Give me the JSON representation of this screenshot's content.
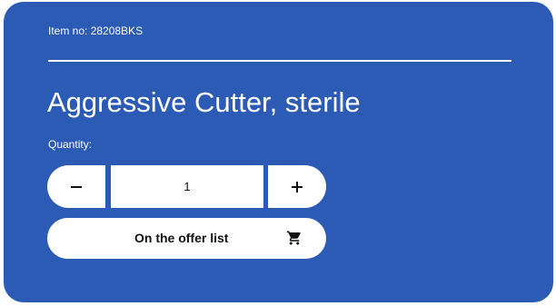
{
  "product": {
    "item_no_label": "Item no: 28208BKS",
    "title": "Aggressive Cutter, sterile"
  },
  "quantity": {
    "label": "Quantity:",
    "value": "1",
    "decrement_icon": "minus-icon",
    "increment_icon": "plus-icon"
  },
  "offer_button": {
    "label": "On the offer list",
    "icon": "cart-icon"
  },
  "colors": {
    "card_background": "#2b5bb5",
    "button_background": "#ffffff",
    "text_light": "#ffffff",
    "text_dark": "#111111"
  }
}
